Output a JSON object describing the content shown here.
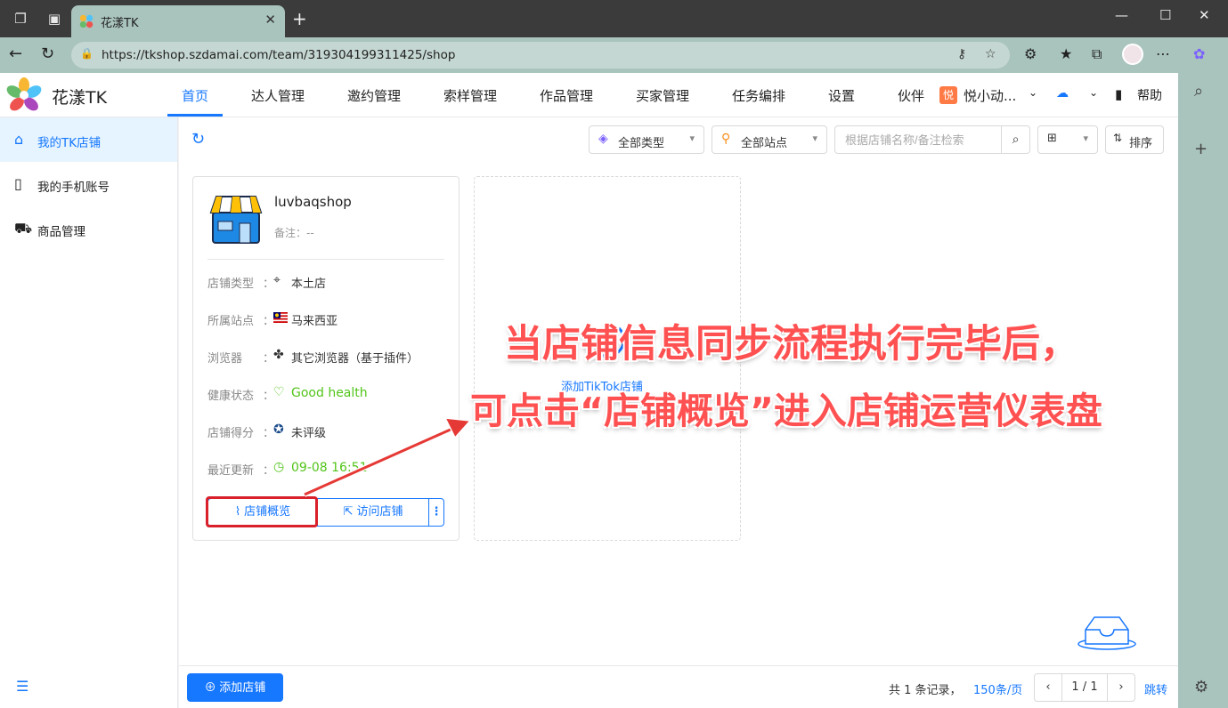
{
  "browser": {
    "tab_title": "花漾TK",
    "url": "https://tkshop.szdamai.com/team/319304199311425/shop"
  },
  "header": {
    "brand": "花漾TK",
    "menu": [
      "首页",
      "达人管理",
      "邀约管理",
      "索样管理",
      "作品管理",
      "买家管理",
      "任务编排",
      "设置",
      "伙伴"
    ],
    "team_badge": "悦",
    "team_name": "悦小动...",
    "help": "帮助"
  },
  "sidebar": {
    "items": [
      {
        "label": "我的TK店铺",
        "icon": "shop-icon"
      },
      {
        "label": "我的手机账号",
        "icon": "phone-icon"
      },
      {
        "label": "商品管理",
        "icon": "cart-icon"
      }
    ]
  },
  "toolbar": {
    "type_filter": "全部类型",
    "site_filter": "全部站点",
    "search_placeholder": "根据店铺名称/备注检索",
    "sort": "排序"
  },
  "shop": {
    "name": "luvbaqshop",
    "remark": "备注：--",
    "rows": [
      {
        "key": "店铺类型",
        "value": "本土店",
        "icon": "location-pin-icon",
        "glyph": "⌖"
      },
      {
        "key": "所属站点",
        "value": "马来西亚",
        "icon": "malaysia-flag-icon",
        "glyph": "▬"
      },
      {
        "key": "浏览器",
        "value": "其它浏览器（基于插件）",
        "icon": "plugin-icon",
        "glyph": "✤"
      },
      {
        "key": "健康状态",
        "value": "Good health",
        "icon": "heart-icon",
        "glyph": "♡"
      },
      {
        "key": "店铺得分",
        "value": "未评级",
        "icon": "badge-icon",
        "glyph": "✪"
      },
      {
        "key": "最近更新",
        "value": "09-08 16:51",
        "icon": "clock-icon",
        "glyph": "◷"
      }
    ],
    "colon": "：",
    "overview_button": "店铺概览",
    "visit_button": "访问店铺"
  },
  "add_card": {
    "label": "添加TikTok店铺"
  },
  "footer": {
    "add_button": "添加店铺",
    "total": "共 1 条记录，",
    "per_page": "150条/页",
    "page": "1 / 1",
    "jump": "跳转"
  },
  "annotation": {
    "line1": "当店铺信息同步流程执行完毕后，",
    "line2": "可点击“店铺概览”进入店铺运营仪表盘",
    "color": "#ff5151",
    "highlight_color": "#d9202b"
  },
  "colors": {
    "accent": "#1677ff",
    "healthy": "#52c41a",
    "browser_chrome": "#a9c3bd"
  }
}
